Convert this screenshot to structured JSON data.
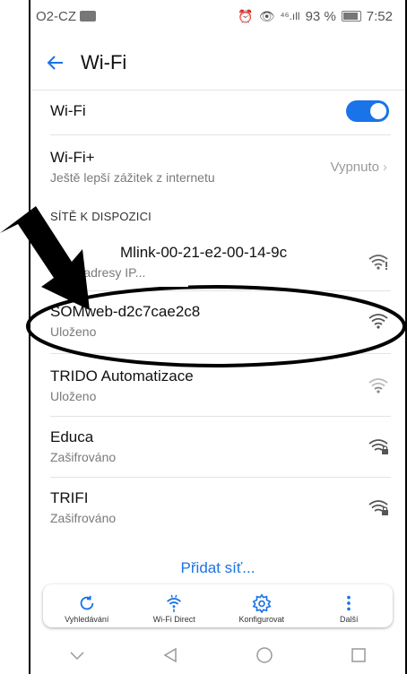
{
  "status": {
    "carrier": "O2-CZ",
    "signal": "⁴⁶.ıll",
    "battery": "93 %",
    "time": "7:52"
  },
  "appbar": {
    "title": "Wi-Fi"
  },
  "wifi_toggle": {
    "label": "Wi-Fi",
    "enabled": true
  },
  "wifi_plus": {
    "label": "Wi-Fi+",
    "subtitle": "Ještě lepší zážitek z internetu",
    "value": "Vypnuto"
  },
  "section_title": "SÍTĚ K DISPOZICI",
  "networks": [
    {
      "name": "Mlink-00-21-e2-00-14-9c",
      "status": "ání adresy IP...",
      "icon": "wifi-warning-icon"
    },
    {
      "name": "SOMweb-d2c7cae2c8",
      "status": "Uloženo",
      "icon": "wifi-icon"
    },
    {
      "name": "TRIDO Automatizace",
      "status": "Uloženo",
      "icon": "wifi-weak-icon"
    },
    {
      "name": "Educa",
      "status": "Zašifrováno",
      "icon": "wifi-lock-icon"
    },
    {
      "name": "TRIFI",
      "status": "Zašifrováno",
      "icon": "wifi-lock-icon"
    }
  ],
  "add_network": "Přidat síť...",
  "toolbar": [
    {
      "label": "Vyhledávání",
      "icon": "refresh-icon"
    },
    {
      "label": "Wi-Fi Direct",
      "icon": "wifi-direct-icon"
    },
    {
      "label": "Konfigurovat",
      "icon": "gear-icon"
    },
    {
      "label": "Další",
      "icon": "more-icon"
    }
  ],
  "colors": {
    "accent": "#1a73e8",
    "annotation": "#000000"
  }
}
